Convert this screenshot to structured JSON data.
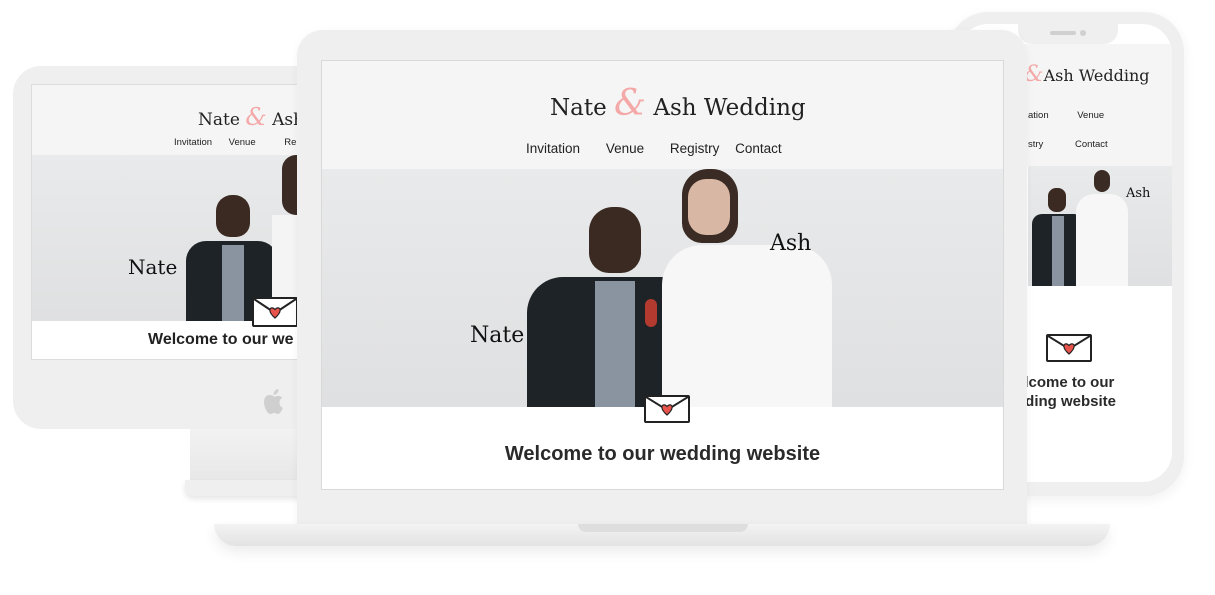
{
  "site": {
    "name_left": "Nate",
    "ampersand": "&",
    "name_right": "Ash",
    "suffix": "Wedding",
    "nav": [
      "Invitation",
      "Venue",
      "Registry",
      "Contact"
    ],
    "photo_label_left": "Nate",
    "photo_label_right": "Ash",
    "welcome": "Welcome to our wedding website",
    "welcome_partial_desktop": "Welcome to our we",
    "welcome_phone_line1": "elcome to our",
    "welcome_phone_line2": "dding website",
    "title_partial_desktop": "Ash W",
    "nav_partial_desktop": "Re",
    "nav_phone": [
      "ation",
      "Venue",
      "stry",
      "Contact"
    ]
  },
  "colors": {
    "accent": "#f4a9a8",
    "header_bg": "#f5f5f5",
    "heart": "#e8534c"
  },
  "icons": {
    "logo": "apple-logo-icon",
    "envelope": "envelope-heart-icon"
  }
}
